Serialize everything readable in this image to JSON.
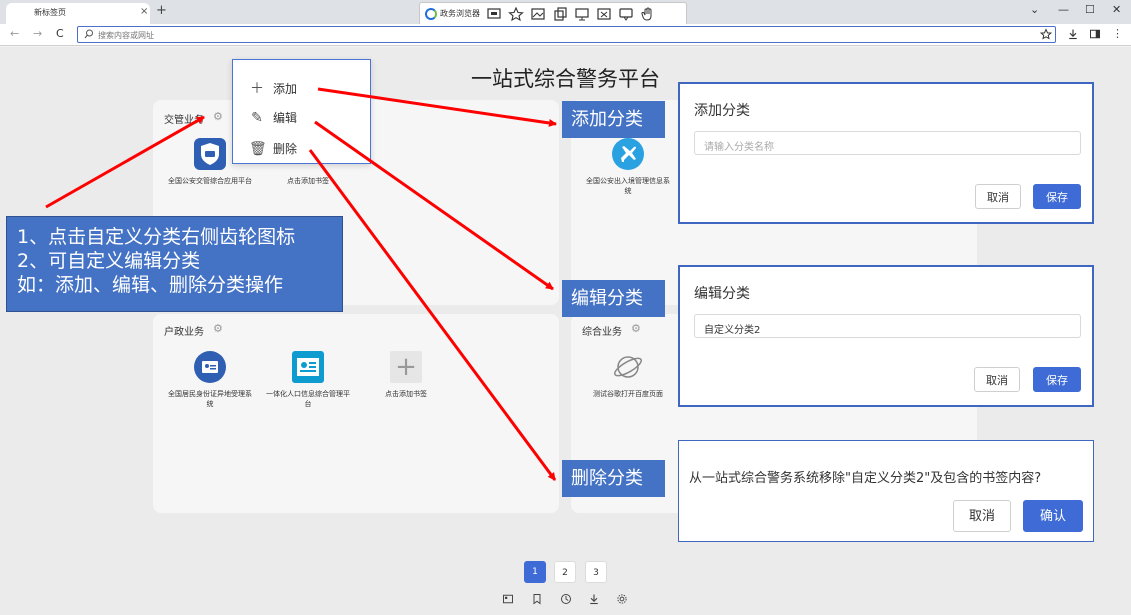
{
  "browser": {
    "tab_title": "新标签页",
    "tab_close": "×",
    "new_tab": "+",
    "extension_name": "政务浏览器",
    "window_controls": [
      "⌄",
      "—",
      "☐",
      "✕"
    ],
    "address_placeholder": "搜索内容或网址",
    "nav": [
      "←",
      "→",
      "C"
    ]
  },
  "page": {
    "title": "一站式综合警务平台",
    "categories": [
      {
        "name": "交管业务",
        "apps": [
          {
            "label": "全国公安交管综合应用平台"
          },
          {
            "label": "点击添加书签"
          }
        ]
      },
      {
        "name": "",
        "apps": [
          {
            "label": "全国公安出入境管理信息系统"
          }
        ]
      },
      {
        "name": "户政业务",
        "apps": [
          {
            "label": "全国居民身份证异地受理系统"
          },
          {
            "label": "一体化人口信息综合管理平台"
          },
          {
            "label": "点击添加书签"
          }
        ]
      },
      {
        "name": "综合业务",
        "apps": [
          {
            "label": "测试谷歌打开百度页面"
          }
        ]
      }
    ],
    "add_icon": "+"
  },
  "menu": {
    "items": [
      {
        "label": "添加",
        "icon": "plus-icon"
      },
      {
        "label": "编辑",
        "icon": "pencil-icon"
      },
      {
        "label": "删除",
        "icon": "trash-icon"
      }
    ]
  },
  "annotation": {
    "lines": [
      "1、点击自定义分类右侧齿轮图标",
      "2、可自定义编辑分类",
      "如：添加、编辑、删除分类操作"
    ]
  },
  "tags": {
    "add": "添加分类",
    "edit": "编辑分类",
    "delete": "删除分类"
  },
  "dialogs": {
    "add": {
      "title": "添加分类",
      "placeholder": "请输入分类名称",
      "cancel": "取消",
      "save": "保存"
    },
    "edit": {
      "title": "编辑分类",
      "value": "自定义分类2",
      "cancel": "取消",
      "save": "保存"
    },
    "delete": {
      "message": "从一站式综合警务系统移除\"自定义分类2\"及包含的书签内容?",
      "cancel": "取消",
      "confirm": "确认"
    }
  },
  "pagination": {
    "pages": [
      "1",
      "2",
      "3"
    ],
    "current": "1"
  },
  "colors": {
    "accent": "#3e6bd6",
    "annotation": "#4472c4",
    "arrow": "#ff0000"
  }
}
